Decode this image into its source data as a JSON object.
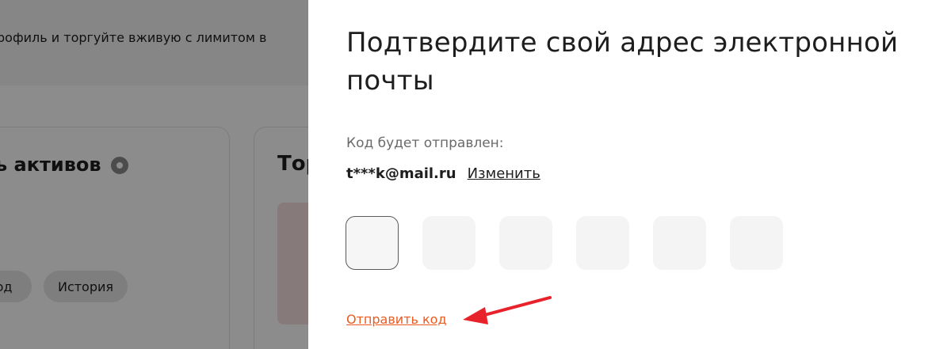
{
  "background": {
    "banner_text": "рофиль и торгуйте вживую с лимитом в",
    "card_left_title": "ь активов",
    "card_right_title": "Тор",
    "pill_left": "од",
    "pill_history": "История"
  },
  "modal": {
    "title": "Подтвердите свой адрес электронной почты",
    "hint": "Код будет отправлен:",
    "email": "t***k@mail.ru",
    "change_link": "Изменить",
    "code_boxes": [
      "",
      "",
      "",
      "",
      "",
      ""
    ],
    "send_code_link": "Отправить код"
  },
  "colors": {
    "accent": "#ec5a1f",
    "annotation_arrow": "#e8222a"
  }
}
